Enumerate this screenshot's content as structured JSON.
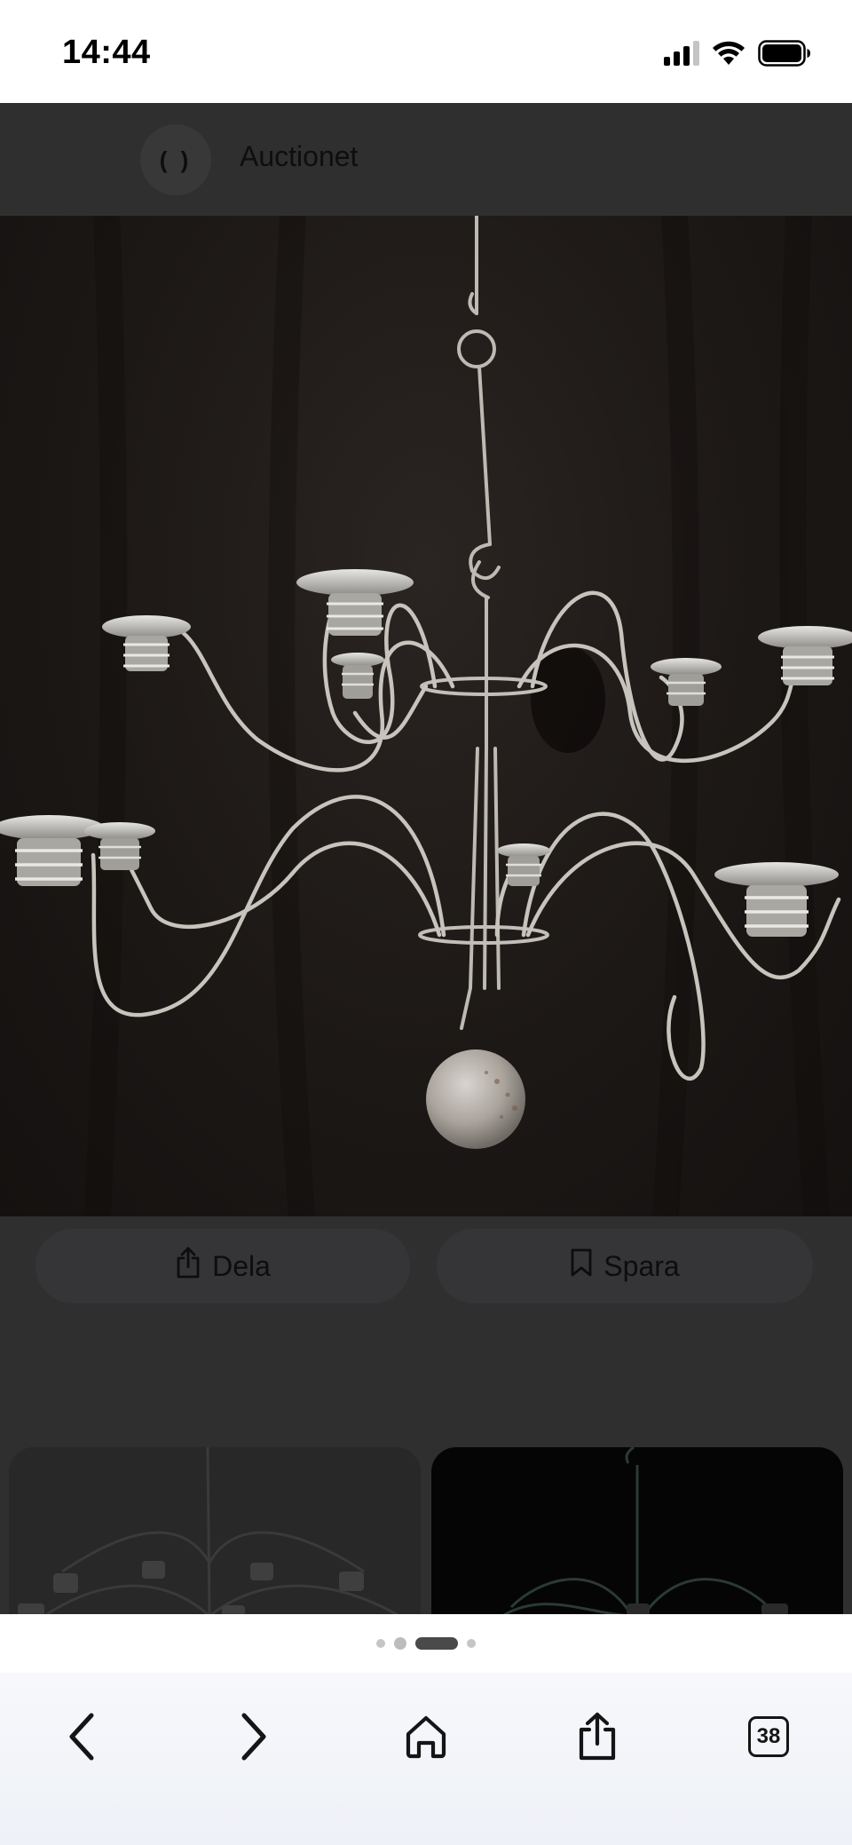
{
  "status_bar": {
    "time": "14:44",
    "icons": [
      "cellular-signal-icon",
      "wifi-icon",
      "battery-icon"
    ]
  },
  "header": {
    "logo_text": "( )",
    "title": "Auctionet"
  },
  "hero_image": {
    "subject": "chandelier",
    "background_color": "#1c1816"
  },
  "actions": {
    "share_label": "Dela",
    "share_icon": "share-icon",
    "save_label": "Spara",
    "save_icon": "bookmark-icon"
  },
  "thumbnails": [
    "chandelier-thumbnail",
    "chandelier-thumbnail"
  ],
  "page_indicator": {
    "count": 4,
    "active_index": 2
  },
  "toolbar": {
    "back_icon": "chevron-left-icon",
    "forward_icon": "chevron-right-icon",
    "home_icon": "home-icon",
    "share_icon": "share-icon",
    "tab_count": "38"
  },
  "colors": {
    "overlay": "#303030",
    "header": "#2f2f30",
    "toolbar": "#f3f5f9",
    "indicator_active": "#4a4a4a",
    "indicator_inactive": "#c5c5c5"
  }
}
